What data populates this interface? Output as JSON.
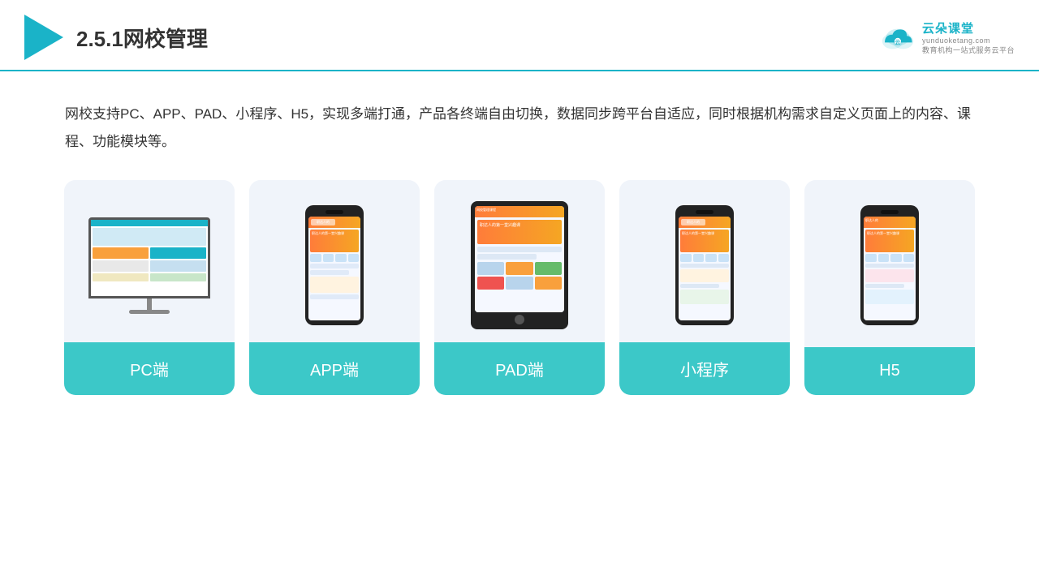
{
  "header": {
    "title": "2.5.1网校管理",
    "brand_name": "云朵课堂",
    "brand_url": "yunduoketang.com",
    "brand_tagline": "教育机构一站式服务云平台"
  },
  "description": "网校支持PC、APP、PAD、小程序、H5，实现多端打通，产品各终端自由切换，数据同步跨平台自适应，同时根据机构需求自定义页面上的内容、课程、功能模块等。",
  "cards": [
    {
      "id": "pc",
      "label": "PC端"
    },
    {
      "id": "app",
      "label": "APP端"
    },
    {
      "id": "pad",
      "label": "PAD端"
    },
    {
      "id": "miniapp",
      "label": "小程序"
    },
    {
      "id": "h5",
      "label": "H5"
    }
  ],
  "colors": {
    "teal": "#3cc8c8",
    "teal_dark": "#1ab3c8",
    "bg_card": "#f0f4fa",
    "text_dark": "#333333"
  }
}
